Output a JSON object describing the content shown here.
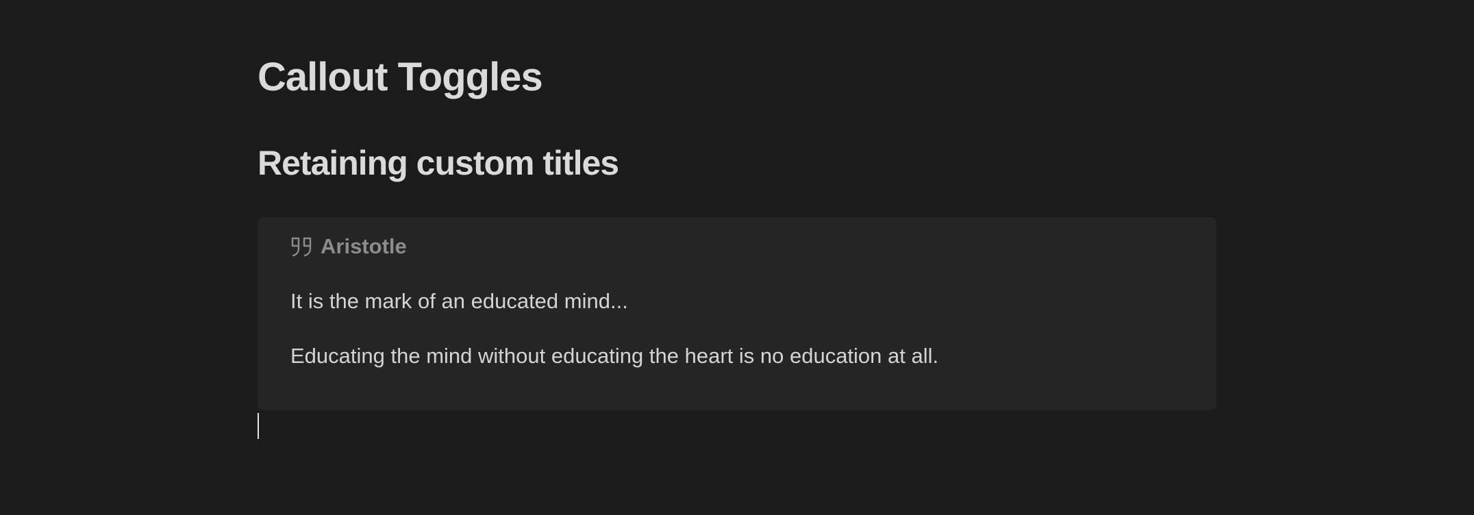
{
  "heading1": "Callout Toggles",
  "heading2": "Retaining custom titles",
  "callout": {
    "icon": "quote-icon",
    "title": "Aristotle",
    "lines": [
      "It is the mark of an educated mind...",
      "Educating the mind without educating the heart is no education at all."
    ]
  },
  "colors": {
    "background": "#1b1b1b",
    "callout_background": "#252525",
    "text": "#dadada",
    "callout_title": "#8c8c8c"
  }
}
